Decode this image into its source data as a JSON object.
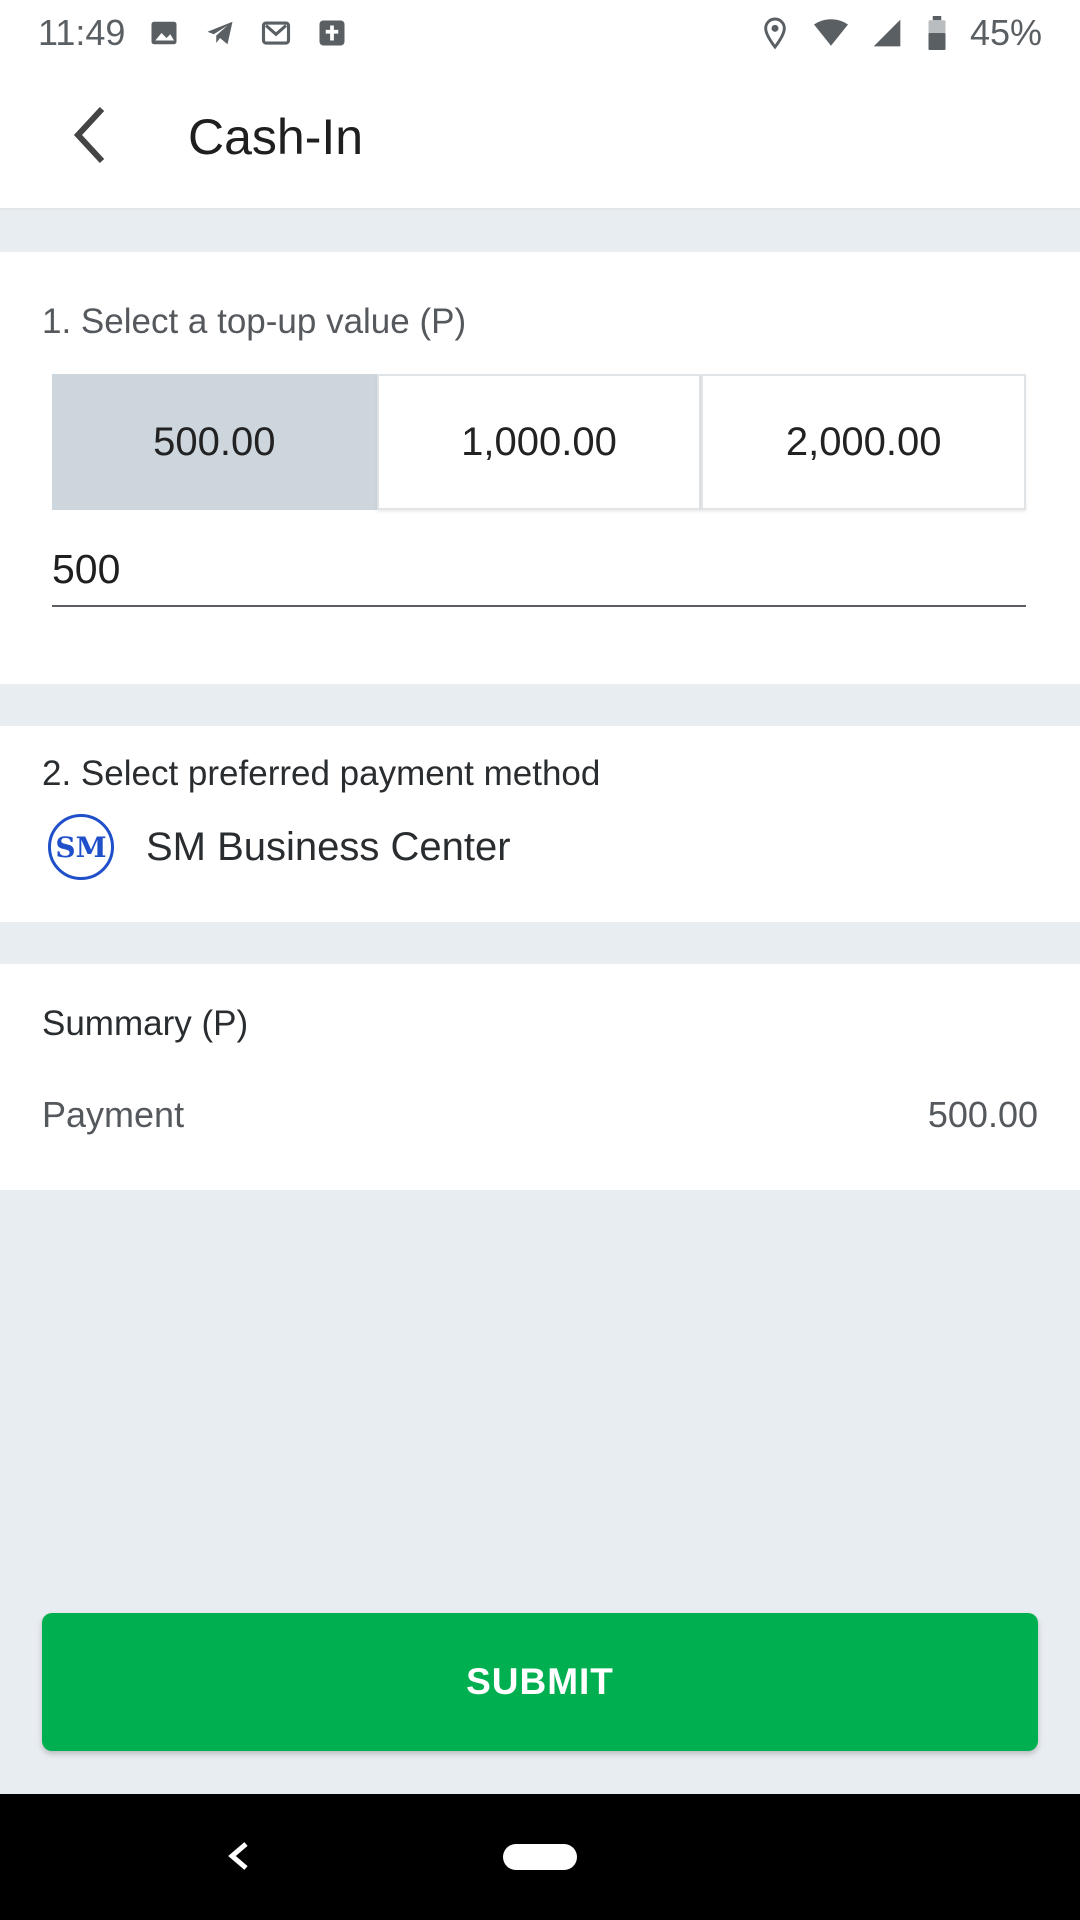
{
  "status_bar": {
    "time": "11:49",
    "battery_percent": "45%",
    "left_icons": [
      "image-icon",
      "telegram-icon",
      "gmail-icon",
      "app-icon"
    ],
    "right_icons": [
      "location-icon",
      "wifi-icon",
      "signal-icon",
      "battery-icon"
    ]
  },
  "app_bar": {
    "title": "Cash-In",
    "back_icon": "chevron-left-icon"
  },
  "topup": {
    "label": "1. Select a top-up value (P)",
    "options": [
      "500.00",
      "1,000.00",
      "2,000.00"
    ],
    "selected_index": 0,
    "amount_value": "500"
  },
  "payment": {
    "label": "2. Select preferred payment method",
    "method_logo_text": "SM",
    "method_name": "SM Business Center"
  },
  "summary": {
    "label": "Summary (P)",
    "payment_label": "Payment",
    "payment_value": "500.00"
  },
  "submit_label": "SUBMIT",
  "colors": {
    "accent_green": "#00b050",
    "selected_option": "#cdd6dd",
    "background": "#e8edf1",
    "logo_blue": "#1f4fc9"
  }
}
